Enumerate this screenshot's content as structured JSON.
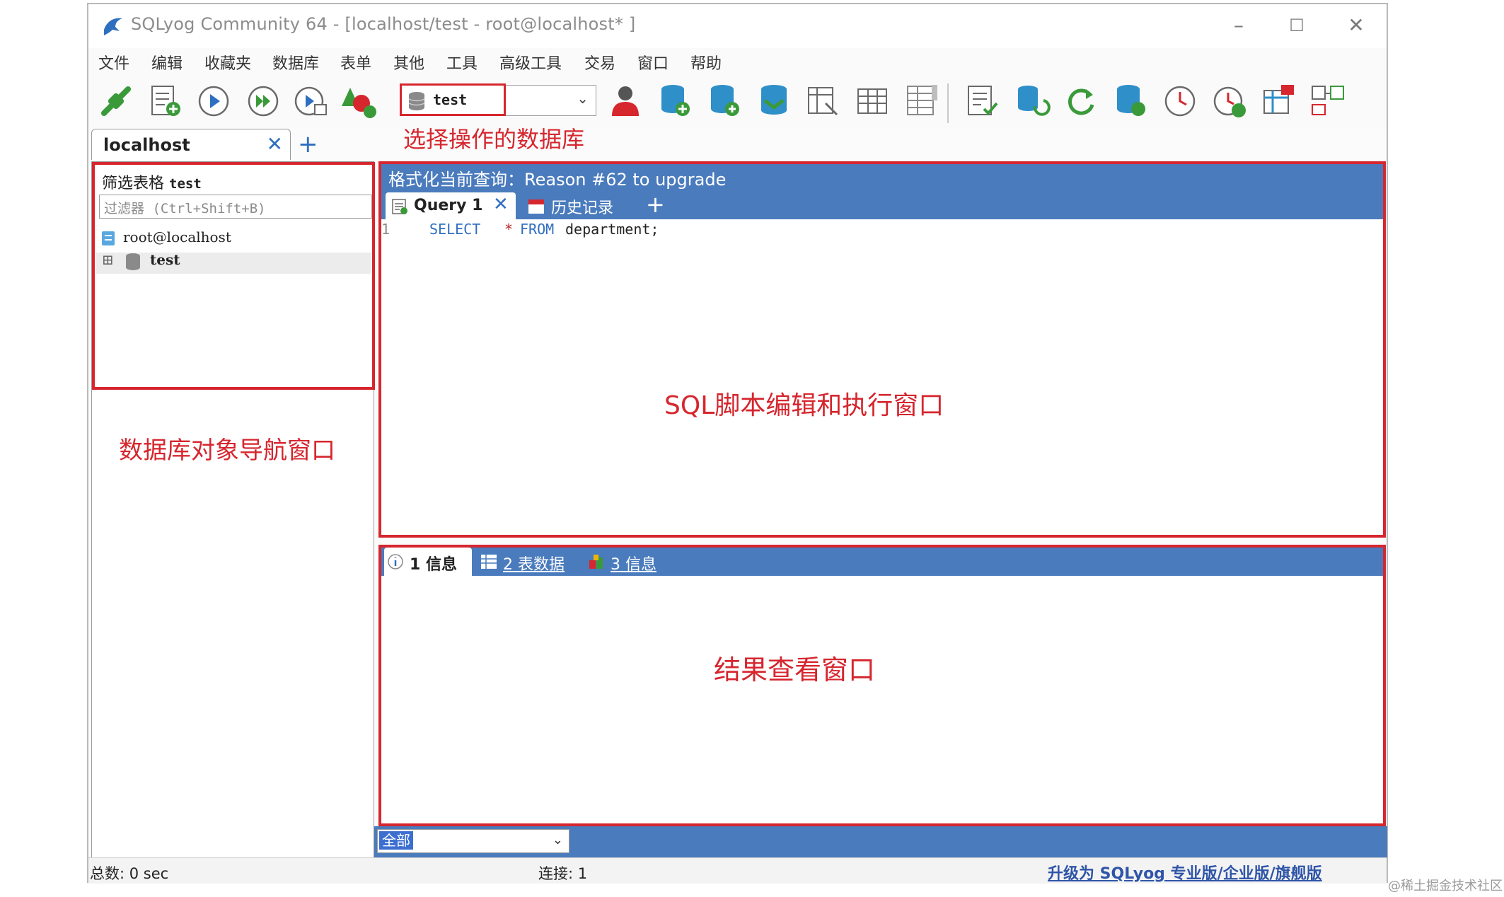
{
  "window": {
    "title": "SQLyog Community 64 - [localhost/test - root@localhost* ]",
    "minimize": "–",
    "maximize": "☐",
    "close": "✕"
  },
  "menu": [
    "文件",
    "编辑",
    "收藏夹",
    "数据库",
    "表单",
    "其他",
    "工具",
    "高级工具",
    "交易",
    "窗口",
    "帮助"
  ],
  "toolbar": {
    "db_select_value": "test",
    "icons": [
      "new-connection-icon",
      "new-query-icon",
      "execute-query-icon",
      "execute-all-icon",
      "execute-edit-icon",
      "schema-designer-icon",
      "user-manager-icon",
      "create-database-icon",
      "alter-database-icon",
      "database-sync-icon",
      "table-diagnostics-icon",
      "table-data-icon",
      "column-view-icon",
      "query-builder-icon",
      "data-sync-icon",
      "refresh-icon",
      "backup-database-icon",
      "scheduled-job-icon",
      "job-history-icon",
      "schema-sync-icon",
      "compare-icon"
    ]
  },
  "connection_tab": {
    "label": "localhost",
    "close": "✕",
    "add": "+"
  },
  "annotations": {
    "db_select": "选择操作的数据库",
    "navigator": "数据库对象导航窗口",
    "editor": "SQL脚本编辑和执行窗口",
    "results": "结果查看窗口"
  },
  "navigator": {
    "filter_label": "筛选表格",
    "filter_db": "test",
    "filter_placeholder": "过滤器 (Ctrl+Shift+B)",
    "tree": [
      {
        "label": "root@localhost"
      },
      {
        "expander": "⊞",
        "label": "test"
      }
    ]
  },
  "editor": {
    "header": "格式化当前查询：Reason #62 to upgrade",
    "query_tab": "Query 1",
    "query_tab_close": "✕",
    "history_tab": "历史记录",
    "add_tab": "+",
    "line_number": "1",
    "code": {
      "select": "SELECT",
      "star": "*",
      "from": "FROM",
      "table": "department;"
    }
  },
  "results": {
    "tabs": [
      {
        "label": "1 信息"
      },
      {
        "label": "2 表数据"
      },
      {
        "label": "3 信息"
      }
    ]
  },
  "bottom_select": {
    "value": "全部"
  },
  "status": {
    "total": "总数: 0 sec",
    "connections": "连接: 1",
    "upgrade_link": "升级为 SQLyog 专业版/企业版/旗舰版"
  },
  "watermark": "@稀土掘金技术社区",
  "colors": {
    "accent_blue": "#4a7bbd",
    "annotation_red": "#d6262e",
    "link_blue": "#2f55a8"
  }
}
